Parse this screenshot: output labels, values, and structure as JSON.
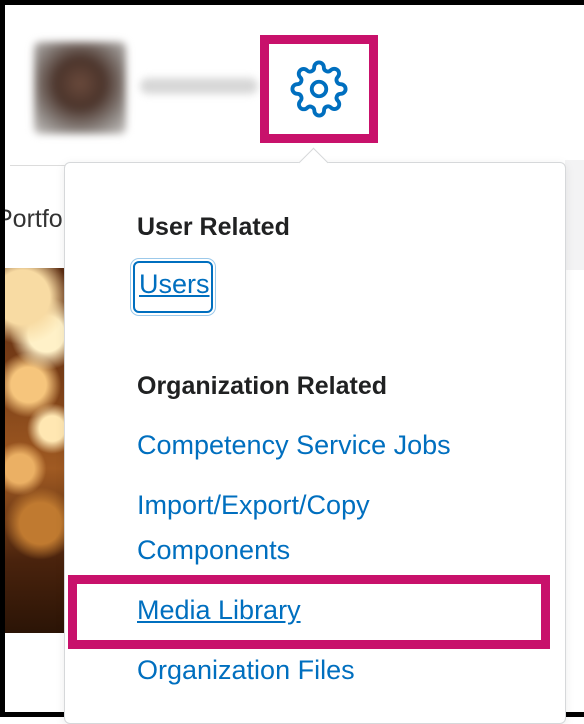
{
  "menu": {
    "user_related_heading": "User Related",
    "users_label": "Users",
    "org_related_heading": "Organization Related",
    "competency_label": "Competency Service Jobs",
    "import_export_line1": "Import/Export/Copy",
    "import_export_line2": "Components",
    "media_library_label": "Media Library",
    "org_files_label": "Organization Files"
  },
  "page": {
    "partial_tab_text": "Portfolio"
  },
  "colors": {
    "link": "#006fbf",
    "highlight": "#c8116b",
    "heading": "#202122"
  },
  "icons": {
    "settings": "gear-icon"
  }
}
